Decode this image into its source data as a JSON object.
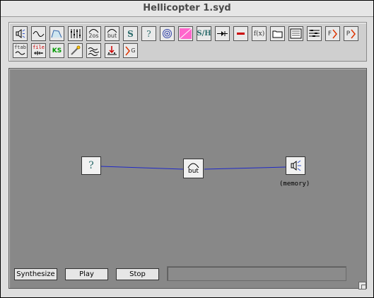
{
  "window": {
    "title": "Hellicopter 1.syd"
  },
  "toolbar": {
    "row1": [
      {
        "name": "speaker-tool",
        "glyph": "speaker"
      },
      {
        "name": "oscillator-tool",
        "glyph": "sine"
      },
      {
        "name": "envelope-tool",
        "glyph": "envelope"
      },
      {
        "name": "mixer-tool",
        "glyph": "mixer"
      },
      {
        "name": "two-pole-filter-tool",
        "glyph": "2os"
      },
      {
        "name": "butterworth-filter-tool",
        "glyph": "but"
      },
      {
        "name": "sample-tool",
        "glyph": "S"
      },
      {
        "name": "random-tool",
        "glyph": "?"
      },
      {
        "name": "spectrum-tool",
        "glyph": "spectrum"
      },
      {
        "name": "pink-noise-tool",
        "glyph": "pink"
      },
      {
        "name": "sample-hold-tool",
        "glyph": "S/H"
      },
      {
        "name": "delay-tool",
        "glyph": "delay"
      },
      {
        "name": "constant-tool",
        "glyph": "minus"
      },
      {
        "name": "expression-tool",
        "glyph": "f(x)"
      },
      {
        "name": "folder-tool",
        "glyph": "folder"
      },
      {
        "name": "notes-tool",
        "glyph": "notes"
      },
      {
        "name": "sequencer-tool",
        "glyph": "seq"
      },
      {
        "name": "f-output-tool",
        "glyph": "F"
      },
      {
        "name": "p-output-tool",
        "glyph": "P"
      }
    ],
    "row2": [
      {
        "name": "ftab-tool",
        "glyph": "ftab"
      },
      {
        "name": "file-tool",
        "glyph": "file"
      },
      {
        "name": "ks-tool",
        "glyph": "KS"
      },
      {
        "name": "wand-tool",
        "glyph": "wand"
      },
      {
        "name": "wave-table-tool",
        "glyph": "waves"
      },
      {
        "name": "granular-tool",
        "glyph": "gran"
      },
      {
        "name": "gate-tool",
        "glyph": "G"
      }
    ],
    "labels": {
      "sine": "~",
      "two_os_num": "2os",
      "but": "but",
      "S": "S",
      "q": "?",
      "sh": "S/H",
      "fx": "f(x)",
      "F": "F",
      "P": "P",
      "ftab": "ftab",
      "file": "file",
      "KS": "KS",
      "G": "G"
    }
  },
  "patch": {
    "nodes": {
      "random": {
        "glyph": "?"
      },
      "filter": {
        "glyph": "but"
      },
      "output": {
        "label": "(memory)"
      }
    },
    "wire_color": "#1e28c8"
  },
  "buttons": {
    "synthesize": "Synthesize",
    "play": "Play",
    "stop": "Stop"
  },
  "status_text": ""
}
